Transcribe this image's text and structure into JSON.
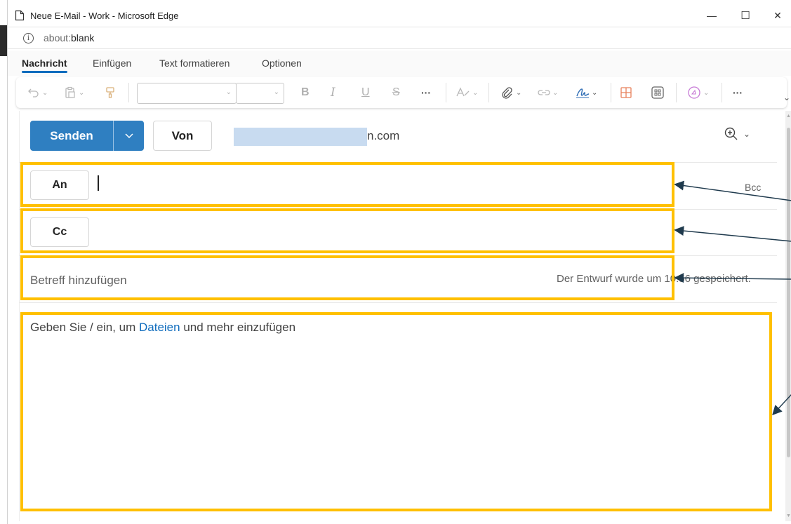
{
  "window": {
    "title": "Neue E-Mail - Work - Microsoft Edge",
    "minimize": "—",
    "maximize": "☐",
    "close": "✕"
  },
  "address_bar": {
    "prefix": "about:",
    "host": "blank"
  },
  "ribbon_tabs": [
    {
      "label": "Nachricht",
      "active": true
    },
    {
      "label": "Einfügen",
      "active": false
    },
    {
      "label": "Text formatieren",
      "active": false
    },
    {
      "label": "Optionen",
      "active": false
    }
  ],
  "toolbar": {
    "bold": "B",
    "italic": "I",
    "underline": "U",
    "strike": "S",
    "more1": "···",
    "more2": "···"
  },
  "compose": {
    "send_label": "Senden",
    "from_label": "Von",
    "from_address_suffix": "n.com",
    "to_label": "An",
    "cc_label": "Cc",
    "bcc_label": "Bcc",
    "subject_placeholder": "Betreff hinzufügen",
    "draft_saved": "Der Entwurf wurde um 10:56 gespeichert.",
    "body_placeholder_before": "Geben Sie / ein, um ",
    "body_placeholder_link": "Dateien",
    "body_placeholder_after": " und mehr einzufügen"
  },
  "colors": {
    "accent": "#0f6cbd",
    "send_button": "#2f7fc1",
    "highlight": "#ffc000",
    "arrow": "#1f3a4d"
  }
}
